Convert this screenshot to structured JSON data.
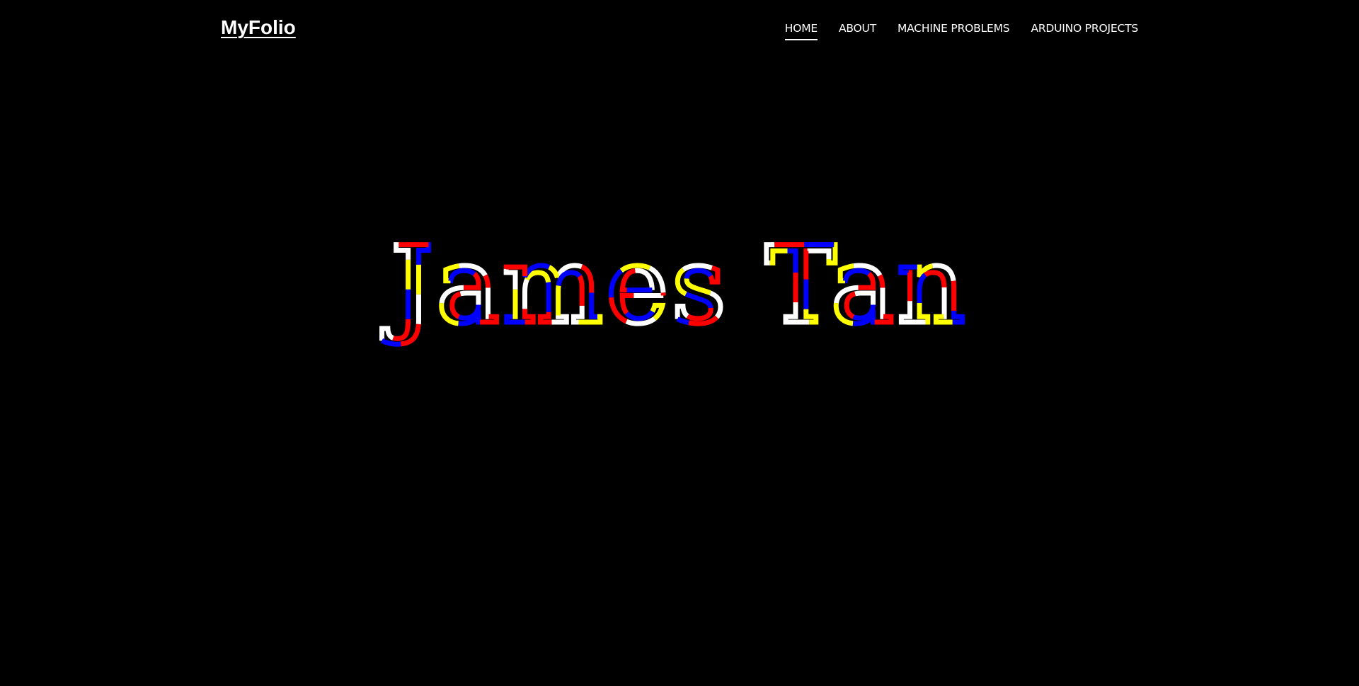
{
  "header": {
    "brand": "MyFolio",
    "nav": [
      {
        "label": "HOME",
        "active": true
      },
      {
        "label": "ABOUT",
        "active": false
      },
      {
        "label": "MACHINE PROBLEMS",
        "active": false
      },
      {
        "label": "ARDUINO PROJECTS",
        "active": false
      }
    ]
  },
  "hero": {
    "name": "James Tan",
    "stroke_colors": [
      "#ffffff",
      "#ffff00",
      "#0000ff",
      "#ff0000"
    ]
  },
  "colors": {
    "background": "#000000",
    "text": "#ffffff"
  }
}
